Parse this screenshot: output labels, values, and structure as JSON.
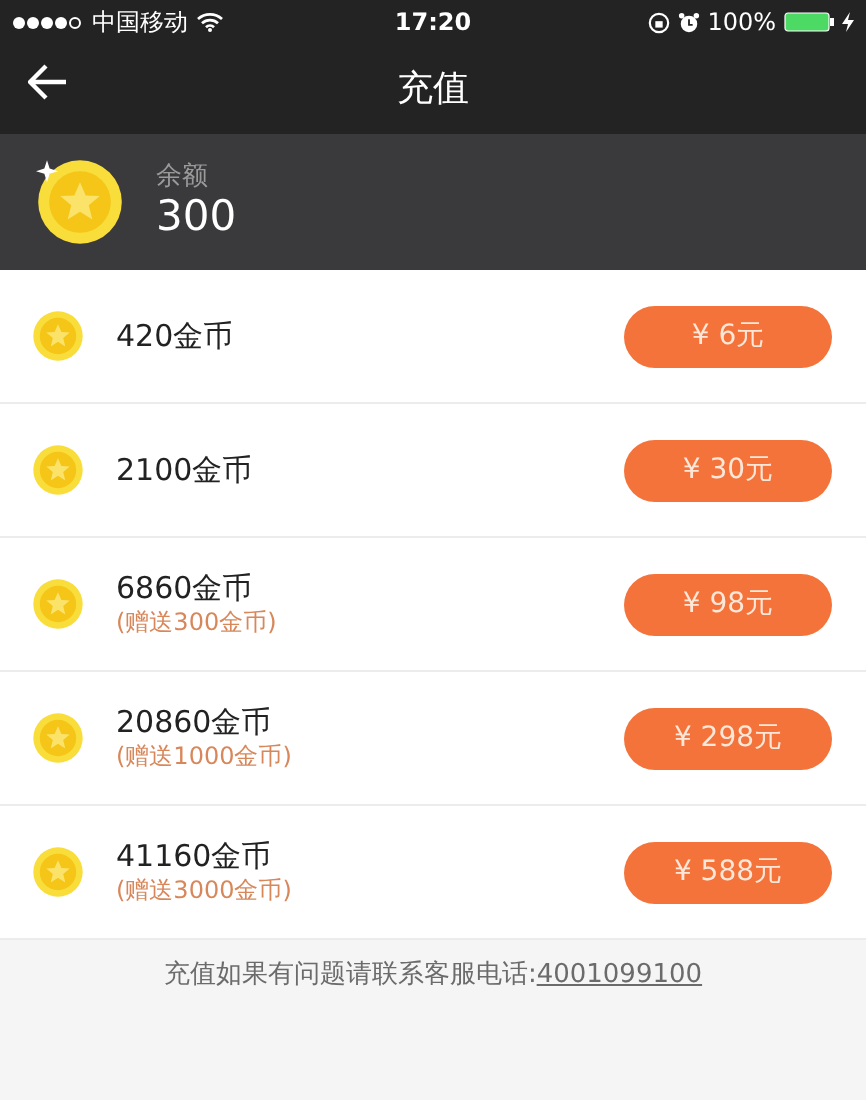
{
  "status_bar": {
    "carrier": "中国移动",
    "time": "17:20",
    "battery": "100%"
  },
  "nav": {
    "title": "充值"
  },
  "balance": {
    "label": "余额",
    "amount": "300"
  },
  "packages": [
    {
      "coins": "420金币",
      "price": "¥ 6元"
    },
    {
      "coins": "2100金币",
      "price": "¥ 30元"
    },
    {
      "coins": "6860金币",
      "bonus": "(赠送300金币)",
      "price": "¥ 98元"
    },
    {
      "coins": "20860金币",
      "bonus": "(赠送1000金币)",
      "price": "¥ 298元"
    },
    {
      "coins": "41160金币",
      "bonus": "(赠送3000金币)",
      "price": "¥ 588元"
    }
  ],
  "footer": {
    "text": "充值如果有问题请联系客服电话:",
    "phone": "4001099100"
  }
}
